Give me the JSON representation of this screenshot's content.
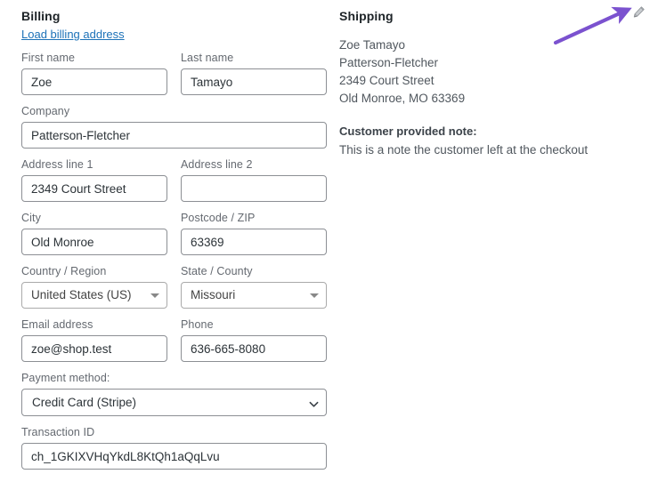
{
  "billing": {
    "title": "Billing",
    "load_link": "Load billing address",
    "fields": {
      "first_name": {
        "label": "First name",
        "value": "Zoe",
        "placeholder": ""
      },
      "last_name": {
        "label": "Last name",
        "value": "Tamayo",
        "placeholder": ""
      },
      "company": {
        "label": "Company",
        "value": "Patterson-Fletcher",
        "placeholder": ""
      },
      "address_1": {
        "label": "Address line 1",
        "value": "2349 Court Street",
        "placeholder": ""
      },
      "address_2": {
        "label": "Address line 2",
        "value": "",
        "placeholder": ""
      },
      "city": {
        "label": "City",
        "value": "Old Monroe",
        "placeholder": ""
      },
      "postcode": {
        "label": "Postcode / ZIP",
        "value": "63369",
        "placeholder": ""
      },
      "country": {
        "label": "Country / Region",
        "value": "United States (US)"
      },
      "state": {
        "label": "State / County",
        "value": "Missouri"
      },
      "email": {
        "label": "Email address",
        "value": "zoe@shop.test",
        "placeholder": ""
      },
      "phone": {
        "label": "Phone",
        "value": "636-665-8080",
        "placeholder": ""
      },
      "payment_method": {
        "label": "Payment method:",
        "value": "Credit Card (Stripe)"
      },
      "transaction_id": {
        "label": "Transaction ID",
        "value": "ch_1GKIXVHqYkdL8KtQh1aQqLvu",
        "placeholder": ""
      }
    }
  },
  "shipping": {
    "title": "Shipping",
    "address_lines": [
      "Zoe Tamayo",
      "Patterson-Fletcher",
      "2349 Court Street",
      "Old Monroe, MO 63369"
    ],
    "note_title": "Customer provided note:",
    "note_body": "This is a note the customer left at the checkout",
    "edit_icon": "pencil-icon"
  },
  "annotation": {
    "arrow_color": "#7b52cf",
    "points_to": "edit-shipping-pencil-icon"
  },
  "colors": {
    "link": "#1d72b8",
    "label": "#646970",
    "text": "#2c3338",
    "border": "#8c8f94",
    "annotation_purple": "#7b52cf"
  }
}
